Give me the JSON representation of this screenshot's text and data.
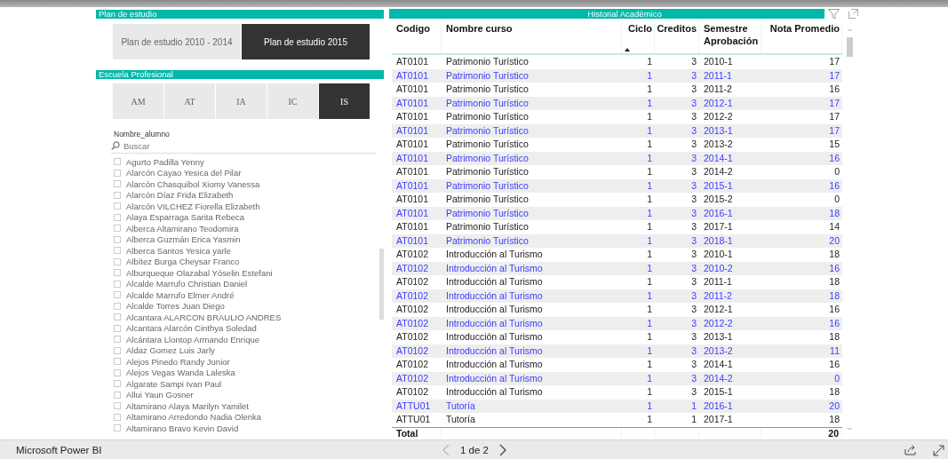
{
  "plan": {
    "title": "Plan de estudio",
    "options": [
      {
        "label": "Plan de estudio 2010 - 2014",
        "selected": false
      },
      {
        "label": "Plan de estudio 2015",
        "selected": true
      }
    ]
  },
  "escuela": {
    "title": "Escuela Profesional",
    "options": [
      {
        "label": "AM",
        "selected": false
      },
      {
        "label": "AT",
        "selected": false
      },
      {
        "label": "IA",
        "selected": false
      },
      {
        "label": "IC",
        "selected": false
      },
      {
        "label": "IS",
        "selected": true
      }
    ]
  },
  "alumnos": {
    "title": "Nombre_alumno",
    "search": {
      "placeholder": "Buscar"
    },
    "items": [
      {
        "label": "Agurto Padilla Yenny",
        "checked": false
      },
      {
        "label": "Alarcón Cayao Yesica del Pilar",
        "checked": false
      },
      {
        "label": "Alarcón Chasquibol Xiomy Vanessa",
        "checked": false
      },
      {
        "label": "Alarcón Díaz Frida Elizabeth",
        "checked": false
      },
      {
        "label": "Alarcón VILCHEZ Fiorella Elizabeth",
        "checked": false
      },
      {
        "label": "Alaya Esparraga Sarita Rebeca",
        "checked": false
      },
      {
        "label": "Alberca Altamirano Teodomira",
        "checked": false
      },
      {
        "label": "Alberca Guzmán Erica Yasmin",
        "checked": false
      },
      {
        "label": "Alberca Santos Yesica yarle",
        "checked": false
      },
      {
        "label": "Albítez Burga Cheysar Franco",
        "checked": false
      },
      {
        "label": "Alburqueque Olazabal Yóselin Estefani",
        "checked": false
      },
      {
        "label": "Alcalde Marrufo Christian Daniel",
        "checked": false
      },
      {
        "label": "Alcalde Marrufo Elmer André",
        "checked": false
      },
      {
        "label": "Alcalde Torres Juan Diego",
        "checked": false
      },
      {
        "label": "Alcantara ALARCON BRAULIO ANDRES",
        "checked": false
      },
      {
        "label": "Alcantara Alarcón Cinthya Soledad",
        "checked": false
      },
      {
        "label": "Alcántara Llontop Armando Enrique",
        "checked": false
      },
      {
        "label": "Aldaz Gomez Luis Jarly",
        "checked": false
      },
      {
        "label": "Alejos Pinedo Randy Junior",
        "checked": false
      },
      {
        "label": "Alejos Vegas Wanda Laleska",
        "checked": false
      },
      {
        "label": "Algarate Sampi Ivan Paul",
        "checked": false
      },
      {
        "label": "Allui Yaun Gosner",
        "checked": false
      },
      {
        "label": "Altamirano Alaya Marilyn Yamilet",
        "checked": false
      },
      {
        "label": "Altamirano Arredondo Nadia Olenka",
        "checked": false
      },
      {
        "label": "Altamirano Bravo Kevin David",
        "checked": false
      }
    ]
  },
  "historial": {
    "title": "Historial Académico",
    "columns": [
      {
        "label": "Codigo",
        "sorted": false
      },
      {
        "label": "Nombre curso",
        "sorted": false
      },
      {
        "label": "Ciclo",
        "sorted": true
      },
      {
        "label": "Creditos",
        "sorted": false
      },
      {
        "label": "Semestre Aprobación",
        "sorted": false
      },
      {
        "label": "Nota Promedio",
        "sorted": false
      }
    ],
    "rows": [
      {
        "cells": [
          "AT0101",
          "Patrimonio Turístico",
          "1",
          "3",
          "2010-1",
          "17"
        ]
      },
      {
        "cells": [
          "AT0101",
          "Patrimonio Turístico",
          "1",
          "3",
          "2011-1",
          "17"
        ]
      },
      {
        "cells": [
          "AT0101",
          "Patrimonio Turístico",
          "1",
          "3",
          "2011-2",
          "16"
        ]
      },
      {
        "cells": [
          "AT0101",
          "Patrimonio Turístico",
          "1",
          "3",
          "2012-1",
          "17"
        ]
      },
      {
        "cells": [
          "AT0101",
          "Patrimonio Turístico",
          "1",
          "3",
          "2012-2",
          "17"
        ]
      },
      {
        "cells": [
          "AT0101",
          "Patrimonio Turístico",
          "1",
          "3",
          "2013-1",
          "17"
        ]
      },
      {
        "cells": [
          "AT0101",
          "Patrimonio Turístico",
          "1",
          "3",
          "2013-2",
          "15"
        ]
      },
      {
        "cells": [
          "AT0101",
          "Patrimonio Turístico",
          "1",
          "3",
          "2014-1",
          "16"
        ]
      },
      {
        "cells": [
          "AT0101",
          "Patrimonio Turístico",
          "1",
          "3",
          "2014-2",
          "0"
        ]
      },
      {
        "cells": [
          "AT0101",
          "Patrimonio Turístico",
          "1",
          "3",
          "2015-1",
          "16"
        ]
      },
      {
        "cells": [
          "AT0101",
          "Patrimonio Turístico",
          "1",
          "3",
          "2015-2",
          "0"
        ]
      },
      {
        "cells": [
          "AT0101",
          "Patrimonio Turístico",
          "1",
          "3",
          "2016-1",
          "18"
        ]
      },
      {
        "cells": [
          "AT0101",
          "Patrimonio Turístico",
          "1",
          "3",
          "2017-1",
          "14"
        ]
      },
      {
        "cells": [
          "AT0101",
          "Patrimonio Turístico",
          "1",
          "3",
          "2018-1",
          "20"
        ]
      },
      {
        "cells": [
          "AT0102",
          "Introducción al Turismo",
          "1",
          "3",
          "2010-1",
          "18"
        ]
      },
      {
        "cells": [
          "AT0102",
          "Introducción al Turismo",
          "1",
          "3",
          "2010-2",
          "16"
        ]
      },
      {
        "cells": [
          "AT0102",
          "Introducción al Turismo",
          "1",
          "3",
          "2011-1",
          "18"
        ]
      },
      {
        "cells": [
          "AT0102",
          "Introducción al Turismo",
          "1",
          "3",
          "2011-2",
          "18"
        ]
      },
      {
        "cells": [
          "AT0102",
          "Introducción al Turismo",
          "1",
          "3",
          "2012-1",
          "16"
        ]
      },
      {
        "cells": [
          "AT0102",
          "Introducción al Turismo",
          "1",
          "3",
          "2012-2",
          "16"
        ]
      },
      {
        "cells": [
          "AT0102",
          "Introducción al Turismo",
          "1",
          "3",
          "2013-1",
          "18"
        ]
      },
      {
        "cells": [
          "AT0102",
          "Introducción al Turismo",
          "1",
          "3",
          "2013-2",
          "11"
        ]
      },
      {
        "cells": [
          "AT0102",
          "Introducción al Turismo",
          "1",
          "3",
          "2014-1",
          "16"
        ]
      },
      {
        "cells": [
          "AT0102",
          "Introducción al Turismo",
          "1",
          "3",
          "2014-2",
          "0"
        ]
      },
      {
        "cells": [
          "AT0102",
          "Introducción al Turismo",
          "1",
          "3",
          "2015-1",
          "18"
        ]
      },
      {
        "cells": [
          "ATTU01",
          "Tutoría",
          "1",
          "1",
          "2016-1",
          "20"
        ]
      },
      {
        "cells": [
          "ATTU01",
          "Tutoría",
          "1",
          "1",
          "2017-1",
          "18"
        ]
      }
    ],
    "total": {
      "label": "Total",
      "value": "20"
    }
  },
  "footer": {
    "app": "Microsoft Power BI",
    "page": "1 de 2"
  }
}
